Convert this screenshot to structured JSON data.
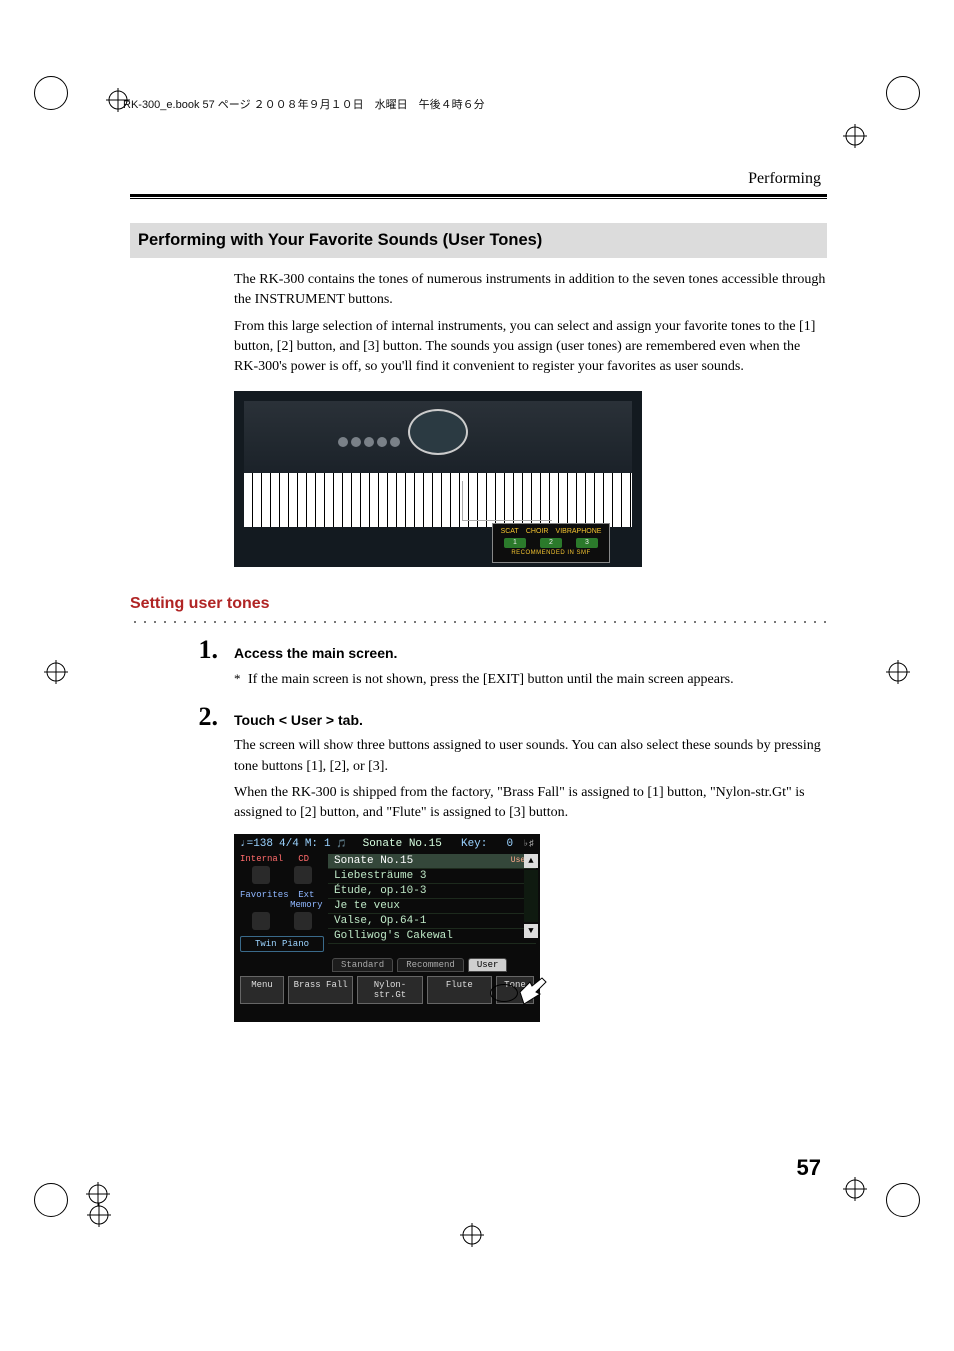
{
  "header_meta": "RK-300_e.book  57 ページ  ２００８年９月１０日　水曜日　午後４時６分",
  "running_head": "Performing",
  "section_title": "Performing with Your Favorite Sounds (User Tones)",
  "intro": {
    "p1": "The RK-300 contains the tones of numerous instruments in addition to the seven tones accessible through the INSTRUMENT buttons.",
    "p2": "From this large selection of internal instruments, you can select and assign your favorite tones to the [1] button, [2] button, and [3] button. The sounds you assign (user tones) are remembered even when the RK-300's power is off, so you'll find it convenient to register your favorites as user sounds."
  },
  "callout": {
    "labels": [
      "SCAT",
      "CHOIR",
      "VIBRAPHONE"
    ],
    "nums": [
      "1",
      "2",
      "3"
    ],
    "sub": "RECOMMENDED IN SMF"
  },
  "subhead": "Setting user tones",
  "steps": {
    "s1": {
      "num": "1.",
      "title": "Access the main screen.",
      "note_mark": "*",
      "note": "If the main screen is not shown, press the [EXIT] button until the main screen appears."
    },
    "s2": {
      "num": "2.",
      "title": "Touch < User > tab.",
      "p1": "The screen will show three buttons assigned to user sounds. You can also select these sounds by pressing tone buttons [1], [2], or [3].",
      "p2": "When the RK-300 is shipped from the factory, \"Brass Fall\" is assigned to [1] button, \"Nylon-str.Gt\" is assigned to [2] button, and \"Flute\" is assigned to [3] button."
    }
  },
  "lcd": {
    "tempo": "♩=138",
    "sig": "4/4",
    "meas_label": "M:",
    "meas": "1",
    "song_icon": "🎵",
    "title": "Sonate No.15",
    "key_label": "Key:",
    "key": "0",
    "left": {
      "row1": [
        "Internal",
        "CD"
      ],
      "row2": [
        "Favorites",
        "Ext Memory"
      ],
      "twin": "Twin Piano"
    },
    "list": [
      {
        "name": "Sonate No.15",
        "tag": "User",
        "selected": true
      },
      {
        "name": "Liebesträume 3"
      },
      {
        "name": "Étude, op.10-3"
      },
      {
        "name": "Je te veux"
      },
      {
        "name": "Valse, Op.64-1"
      },
      {
        "name": "Golliwog's Cakewal"
      }
    ],
    "scroll_up": "▲",
    "scroll_down": "▼",
    "tabs": {
      "standard": "Standard",
      "recommend": "Recommend",
      "user": "User"
    },
    "bottom": {
      "menu": "Menu",
      "b1": "Brass Fall",
      "b2": "Nylon-str.Gt",
      "b3": "Flute",
      "tone": "Tone"
    }
  },
  "page_number": "57"
}
